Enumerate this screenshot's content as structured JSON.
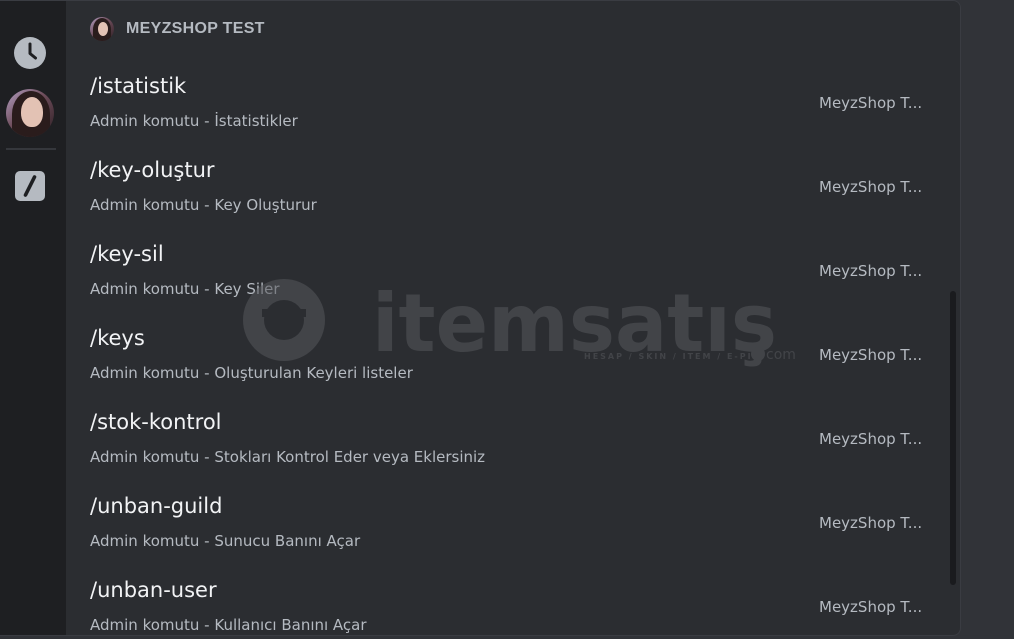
{
  "header": {
    "title": "MEYZSHOP TEST"
  },
  "rail": {
    "items": [
      {
        "icon": "clock-icon"
      },
      {
        "icon": "server-avatar"
      },
      {
        "icon": "slash-command-icon"
      }
    ]
  },
  "commands": [
    {
      "name": "/istatistik",
      "description": "Admin komutu - İstatistikler",
      "source": "MeyzShop T..."
    },
    {
      "name": "/key-oluştur",
      "description": "Admin komutu - Key Oluşturur",
      "source": "MeyzShop T..."
    },
    {
      "name": "/key-sil",
      "description": "Admin komutu - Key Siler",
      "source": "MeyzShop T..."
    },
    {
      "name": "/keys",
      "description": "Admin komutu - Oluşturulan Keyleri listeler",
      "source": "MeyzShop T..."
    },
    {
      "name": "/stok-kontrol",
      "description": "Admin komutu - Stokları Kontrol Eder veya Eklersiniz",
      "source": "MeyzShop T..."
    },
    {
      "name": "/unban-guild",
      "description": "Admin komutu - Sunucu Banını Açar",
      "source": "MeyzShop T..."
    },
    {
      "name": "/unban-user",
      "description": "Admin komutu - Kullanıcı Banını Açar",
      "source": "MeyzShop T..."
    }
  ],
  "watermark": {
    "brand": "itemsatış",
    "tagline": "HESAP / SKIN / ITEM / E-PIN",
    "suffix": "com"
  },
  "colors": {
    "background": "#2b2d31",
    "rail": "#1e1f22",
    "text_primary": "#f2f3f5",
    "text_secondary": "#b5bac1"
  }
}
